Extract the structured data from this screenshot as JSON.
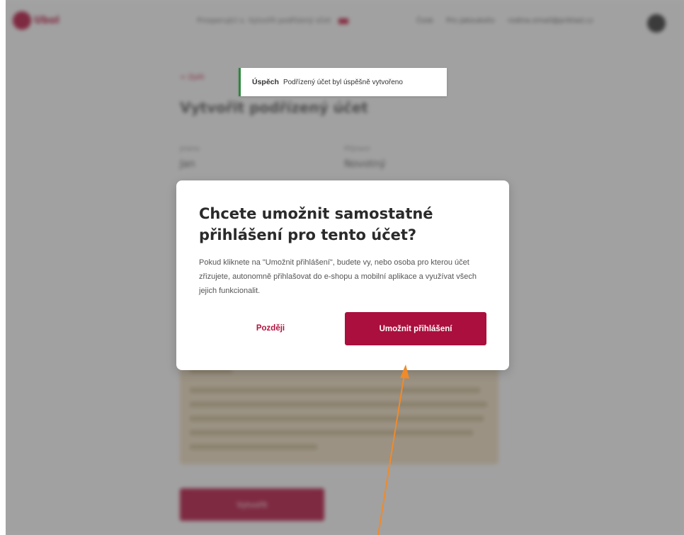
{
  "header": {
    "logo_text": "Ubol",
    "nav_mid": [
      "Prosperující s. Vytvořit podřízený účet"
    ],
    "nav_right": [
      "Česk",
      "Pro Jakoukoliv",
      "rodina.email@priklad.cz"
    ]
  },
  "page": {
    "back_link": "< Zpět",
    "title": "Vytvořit podřízený účet",
    "fields": [
      {
        "label": "Jméno",
        "value": "Jan"
      },
      {
        "label": "Příjmení",
        "value": "Novotný"
      }
    ],
    "submit_label": "Vytvořit"
  },
  "toast": {
    "title": "Úspěch",
    "message": "Podřízený účet byl úspěšně vytvořeno"
  },
  "modal": {
    "title": "Chcete umožnit samostatné přihlášení pro tento účet?",
    "text": "Pokud kliknete na \"Umožnit přihlášení\", budete vy, nebo osoba pro kterou účet zřizujete, autonomně přihlašovat do e-shopu a mobilní aplikace a využívat všech jejich funkcionalit.",
    "later_label": "Později",
    "allow_label": "Umožnit přihlášení"
  },
  "colors": {
    "brand": "#aa0f3d",
    "success": "#2a8a3c",
    "annotation_arrow": "#f08a2a"
  }
}
